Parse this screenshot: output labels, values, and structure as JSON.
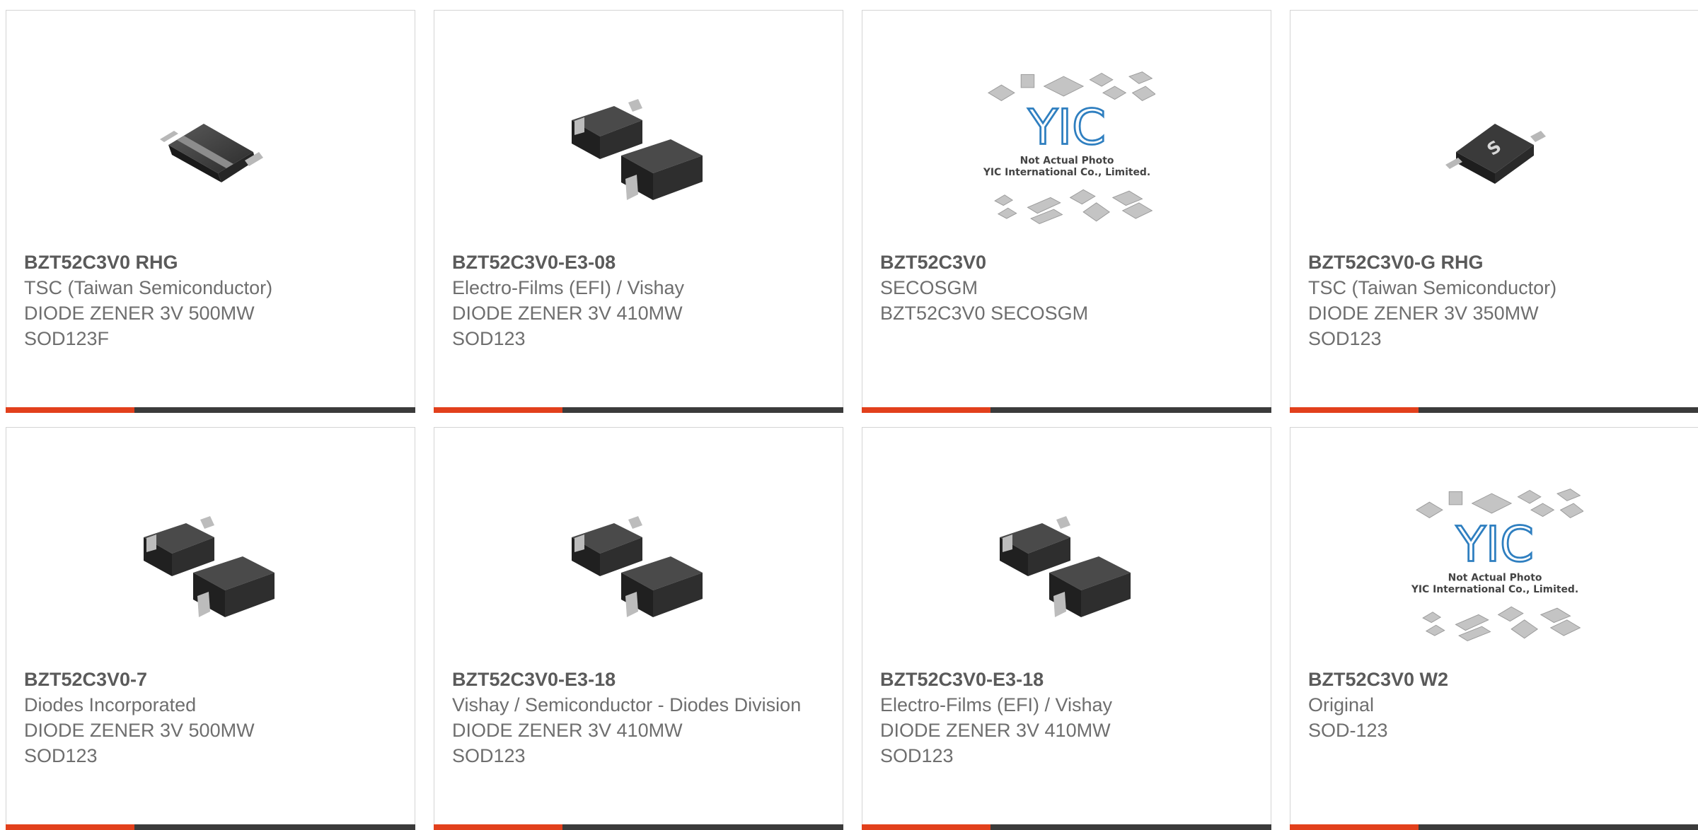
{
  "colors": {
    "accent": "#e2401c",
    "bar": "#3b3b3b",
    "border": "#d4d4d4",
    "text": "#6e6e6e",
    "part_number": "#5a5a5a"
  },
  "products": [
    {
      "part_number": "BZT52C3V0 RHG",
      "manufacturer": "TSC (Taiwan Semiconductor)",
      "description": "DIODE ZENER 3V 500MW",
      "package": "SOD123F",
      "image": "sod123f-chip-icon"
    },
    {
      "part_number": "BZT52C3V0-E3-08",
      "manufacturer": "Electro-Films (EFI) / Vishay",
      "description": "DIODE ZENER 3V 410MW",
      "package": "SOD123",
      "image": "sod123-pair-icon"
    },
    {
      "part_number": "BZT52C3V0",
      "manufacturer": "SECOSGM",
      "description": "BZT52C3V0 SECOSGM",
      "package": "",
      "image": "yic-placeholder-icon",
      "placeholder_line1": "Not Actual Photo",
      "placeholder_line2": "YIC International Co., Limited.",
      "placeholder_logo": "YIC"
    },
    {
      "part_number": "BZT52C3V0-G RHG",
      "manufacturer": "TSC (Taiwan Semiconductor)",
      "description": "DIODE ZENER 3V 350MW",
      "package": "SOD123",
      "image": "sod123-tsc-chip-icon"
    },
    {
      "part_number": "BZT52C3V0-7",
      "manufacturer": "Diodes Incorporated",
      "description": "DIODE ZENER 3V 500MW",
      "package": "SOD123",
      "image": "sod123-pair-icon"
    },
    {
      "part_number": "BZT52C3V0-E3-18",
      "manufacturer": "Vishay / Semiconductor - Diodes Division",
      "description": "DIODE ZENER 3V 410MW",
      "package": "SOD123",
      "image": "sod123-pair-icon"
    },
    {
      "part_number": "BZT52C3V0-E3-18",
      "manufacturer": "Electro-Films (EFI) / Vishay",
      "description": "DIODE ZENER 3V 410MW",
      "package": "SOD123",
      "image": "sod123-pair-icon"
    },
    {
      "part_number": "BZT52C3V0 W2",
      "manufacturer": "Original",
      "description": "SOD-123",
      "package": "",
      "image": "yic-placeholder-icon",
      "placeholder_line1": "Not Actual Photo",
      "placeholder_line2": "YIC International Co., Limited.",
      "placeholder_logo": "YIC"
    }
  ]
}
